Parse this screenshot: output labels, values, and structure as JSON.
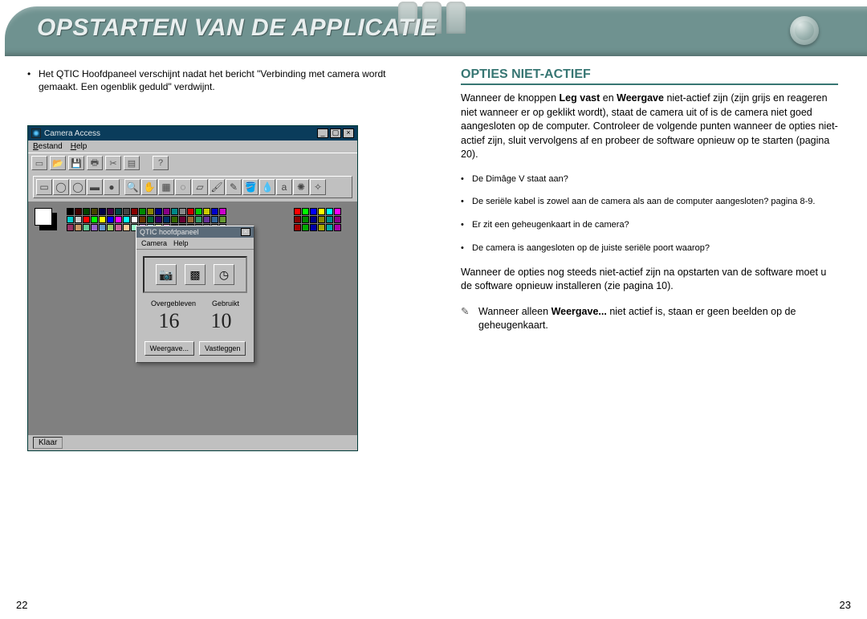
{
  "header": {
    "title": "OPSTARTEN VAN DE APPLICATIE"
  },
  "left": {
    "bullet1": "Het QTIC Hoofdpaneel verschijnt nadat het bericht \"Verbinding met camera wordt gemaakt. Een ogenblik geduld\" verdwijnt."
  },
  "right": {
    "heading": "OPTIES NIET-ACTIEF",
    "para1_pre": "Wanneer de knoppen ",
    "para1_b1": "Leg vast",
    "para1_mid": " en ",
    "para1_b2": "Weergave",
    "para1_post": " niet-actief zijn (zijn grijs en reageren niet wanneer er op geklikt wordt), staat de camera uit of is de camera niet goed aangesloten op de computer. Controleer de volgende punten wanneer de opties niet-actief zijn, sluit vervolgens af en probeer de software opnieuw op te starten (pagina 20).",
    "check1": "De Dimâge V staat aan?",
    "check2": "De seriële kabel is zowel aan de camera als aan de computer aangesloten? pagina 8-9.",
    "check3": "Er zit een geheugenkaart in de camera?",
    "check4": "De camera is aangesloten op de juiste seriële poort waarop?",
    "para2": "Wanneer de opties nog steeds niet-actief zijn na opstarten van de software moet u de software opnieuw installeren (zie pagina 10).",
    "pencil_pre": "Wanneer alleen ",
    "pencil_b": "Weergave...",
    "pencil_post": " niet actief is, staan er geen beelden op de geheugenkaart."
  },
  "screenshot": {
    "main_title": "Camera Access",
    "menu_file": "Bestand",
    "menu_help": "Help",
    "qtic_title": "QTIC hoofdpaneel",
    "qtic_menu_camera": "Camera",
    "qtic_menu_help": "Help",
    "label_left": "Overgebleven",
    "label_right": "Gebruikt",
    "count_left": "16",
    "count_right": "10",
    "btn_weergave": "Weergave...",
    "btn_vastleggen": "Vastleggen",
    "status": "Klaar"
  },
  "pages": {
    "left": "22",
    "right": "23"
  }
}
